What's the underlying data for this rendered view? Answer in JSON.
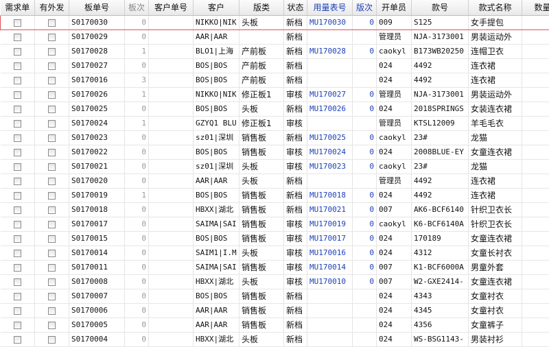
{
  "headers": {
    "need_order": "需求单",
    "outsource": "有外发",
    "board_no": "板单号",
    "board_times": "板次",
    "customer_no": "客户单号",
    "customer": "客户",
    "board_type": "版类",
    "status": "状态",
    "usage_no": "用量表号",
    "version": "版次",
    "creator": "开单员",
    "style_no": "款号",
    "style_name": "款式名称",
    "quantity": "数量"
  },
  "rows": [
    {
      "board_no": "S0170030",
      "board_times": "0",
      "customer": "NIKKO|NIK",
      "board_type": "头板",
      "status": "新档",
      "usage_no": "MU170030",
      "version": "0",
      "creator": "009",
      "style_no": "S125",
      "style_name": "女手提包"
    },
    {
      "board_no": "S0170029",
      "board_times": "0",
      "customer": "AAR|AAR",
      "board_type": "",
      "status": "新档",
      "usage_no": "",
      "version": "",
      "creator": "管理员",
      "style_no": "NJA-3173001",
      "style_name": "男装运动外"
    },
    {
      "board_no": "S0170028",
      "board_times": "1",
      "customer": "BLO1|上海",
      "board_type": "产前板",
      "status": "新档",
      "usage_no": "MU170028",
      "version": "0",
      "creator": "caokyl",
      "style_no": "B173WB20250",
      "style_name": "连帽卫衣"
    },
    {
      "board_no": "S0170027",
      "board_times": "0",
      "customer": "BOS|BOS",
      "board_type": "产前板",
      "status": "新档",
      "usage_no": "",
      "version": "",
      "creator": "024",
      "style_no": "4492",
      "style_name": "连衣裙"
    },
    {
      "board_no": "S0170016",
      "board_times": "3",
      "customer": "BOS|BOS",
      "board_type": "产前板",
      "status": "新档",
      "usage_no": "",
      "version": "",
      "creator": "024",
      "style_no": "4492",
      "style_name": "连衣裙"
    },
    {
      "board_no": "S0170026",
      "board_times": "1",
      "customer": "NIKKO|NIK",
      "board_type": "修正板1",
      "status": "审核",
      "usage_no": "MU170027",
      "version": "0",
      "creator": "管理员",
      "style_no": "NJA-3173001",
      "style_name": "男装运动外"
    },
    {
      "board_no": "S0170025",
      "board_times": "0",
      "customer": "BOS|BOS",
      "board_type": "头板",
      "status": "新档",
      "usage_no": "MU170026",
      "version": "0",
      "creator": "024",
      "style_no": "2018SPRINGS",
      "style_name": "女装连衣裙"
    },
    {
      "board_no": "S0170024",
      "board_times": "1",
      "customer": "GZYQ1 BLU",
      "board_type": "修正板1",
      "status": "审核",
      "usage_no": "",
      "version": "",
      "creator": "管理员",
      "style_no": "KTSL12009",
      "style_name": "羊毛毛衣"
    },
    {
      "board_no": "S0170023",
      "board_times": "0",
      "customer": "sz01|深圳",
      "board_type": "销售板",
      "status": "新档",
      "usage_no": "MU170025",
      "version": "0",
      "creator": "caokyl",
      "style_no": "23#",
      "style_name": "龙猫"
    },
    {
      "board_no": "S0170022",
      "board_times": "0",
      "customer": "BOS|BOS",
      "board_type": "销售板",
      "status": "审核",
      "usage_no": "MU170024",
      "version": "0",
      "creator": "024",
      "style_no": "2008BLUE-EY",
      "style_name": "女童连衣裙"
    },
    {
      "board_no": "S0170021",
      "board_times": "0",
      "customer": "sz01|深圳",
      "board_type": "头板",
      "status": "审核",
      "usage_no": "MU170023",
      "version": "0",
      "creator": "caokyl",
      "style_no": "23#",
      "style_name": "龙猫"
    },
    {
      "board_no": "S0170020",
      "board_times": "0",
      "customer": "AAR|AAR",
      "board_type": "头板",
      "status": "新档",
      "usage_no": "",
      "version": "",
      "creator": "管理员",
      "style_no": "4492",
      "style_name": "连衣裙"
    },
    {
      "board_no": "S0170019",
      "board_times": "1",
      "customer": "BOS|BOS",
      "board_type": "销售板",
      "status": "新档",
      "usage_no": "MU170018",
      "version": "0",
      "creator": "024",
      "style_no": "4492",
      "style_name": "连衣裙"
    },
    {
      "board_no": "S0170018",
      "board_times": "0",
      "customer": "HBXX|湖北",
      "board_type": "销售板",
      "status": "新档",
      "usage_no": "MU170021",
      "version": "0",
      "creator": "007",
      "style_no": "AK6-BCF6140",
      "style_name": "针织卫衣长"
    },
    {
      "board_no": "S0170017",
      "board_times": "0",
      "customer": "SAIMA|SAI",
      "board_type": "销售板",
      "status": "审核",
      "usage_no": "MU170019",
      "version": "0",
      "creator": "caokyl",
      "style_no": "K6-BCF6140A",
      "style_name": "针织卫衣长"
    },
    {
      "board_no": "S0170015",
      "board_times": "0",
      "customer": "BOS|BOS",
      "board_type": "销售板",
      "status": "审核",
      "usage_no": "MU170017",
      "version": "0",
      "creator": "024",
      "style_no": "170189",
      "style_name": "女童连衣裙"
    },
    {
      "board_no": "S0170014",
      "board_times": "0",
      "customer": "SAIM1|I.M",
      "board_type": "头板",
      "status": "审核",
      "usage_no": "MU170016",
      "version": "0",
      "creator": "024",
      "style_no": "4312",
      "style_name": "女童长衬衣"
    },
    {
      "board_no": "S0170011",
      "board_times": "0",
      "customer": "SAIMA|SAI",
      "board_type": "销售板",
      "status": "审核",
      "usage_no": "MU170014",
      "version": "0",
      "creator": "007",
      "style_no": "K1-BCF6000A",
      "style_name": "男童外套"
    },
    {
      "board_no": "S0170008",
      "board_times": "0",
      "customer": "HBXX|湖北",
      "board_type": "头板",
      "status": "审核",
      "usage_no": "MU170010",
      "version": "0",
      "creator": "007",
      "style_no": "W2-GXE2414-",
      "style_name": "女童连衣裙"
    },
    {
      "board_no": "S0170007",
      "board_times": "0",
      "customer": "BOS|BOS",
      "board_type": "销售板",
      "status": "新档",
      "usage_no": "",
      "version": "",
      "creator": "024",
      "style_no": "4343",
      "style_name": "女童衬衣"
    },
    {
      "board_no": "S0170006",
      "board_times": "0",
      "customer": "AAR|AAR",
      "board_type": "销售板",
      "status": "新档",
      "usage_no": "",
      "version": "",
      "creator": "024",
      "style_no": "4345",
      "style_name": "女童衬衣"
    },
    {
      "board_no": "S0170005",
      "board_times": "0",
      "customer": "AAR|AAR",
      "board_type": "销售板",
      "status": "新档",
      "usage_no": "",
      "version": "",
      "creator": "024",
      "style_no": "4356",
      "style_name": "女童裤子"
    },
    {
      "board_no": "S0170004",
      "board_times": "0",
      "customer": "HBXX|湖北",
      "board_type": "头板",
      "status": "新档",
      "usage_no": "",
      "version": "",
      "creator": "024",
      "style_no": "WS-BSG1143-",
      "style_name": "男装衬衫"
    }
  ]
}
